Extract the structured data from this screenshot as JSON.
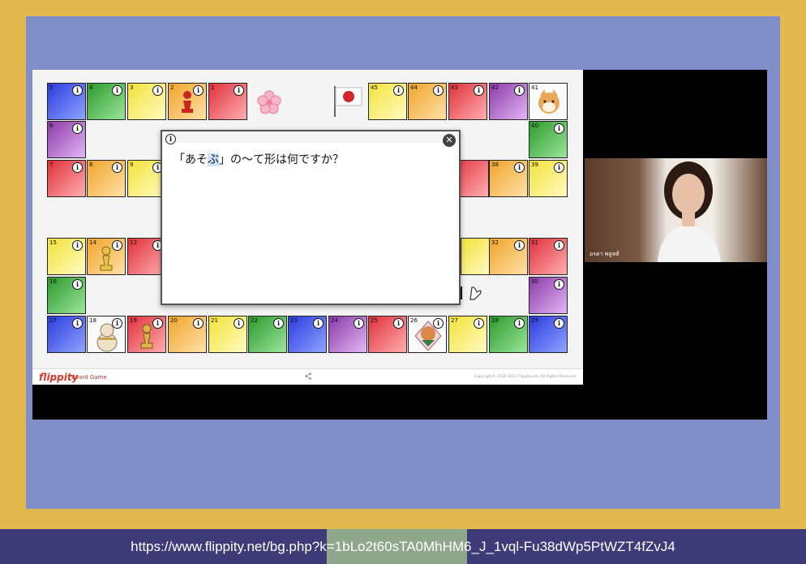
{
  "app": {
    "brand": "flippity",
    "subtitle": "Board Game",
    "copyright": "Copyright© 2020-2021 Flippity.net. All Rights Reserved"
  },
  "icons": {
    "info": "i",
    "close": "✕",
    "share": "share-icon"
  },
  "tiles": [
    {
      "n": "5",
      "c": "blue"
    },
    {
      "n": "4",
      "c": "green"
    },
    {
      "n": "3",
      "c": "yellow"
    },
    {
      "n": "2",
      "c": "orange"
    },
    {
      "n": "1",
      "c": "red"
    },
    {
      "n": "45",
      "c": "yellow"
    },
    {
      "n": "44",
      "c": "orange"
    },
    {
      "n": "43",
      "c": "red"
    },
    {
      "n": "42",
      "c": "purple"
    },
    {
      "n": "41",
      "c": "white"
    },
    {
      "n": "6",
      "c": "purple"
    },
    {
      "n": "40",
      "c": "green"
    },
    {
      "n": "7",
      "c": "red"
    },
    {
      "n": "8",
      "c": "orange"
    },
    {
      "n": "9",
      "c": "yellow"
    },
    {
      "n": "38",
      "c": "orange"
    },
    {
      "n": "39",
      "c": "yellow"
    },
    {
      "n": "15",
      "c": "yellow"
    },
    {
      "n": "14",
      "c": "orange"
    },
    {
      "n": "13",
      "c": "red"
    },
    {
      "n": "32",
      "c": "orange"
    },
    {
      "n": "31",
      "c": "red"
    },
    {
      "n": "16",
      "c": "green"
    },
    {
      "n": "30",
      "c": "purple"
    },
    {
      "n": "17",
      "c": "blue"
    },
    {
      "n": "18",
      "c": "white"
    },
    {
      "n": "19",
      "c": "red"
    },
    {
      "n": "20",
      "c": "orange"
    },
    {
      "n": "21",
      "c": "yellow"
    },
    {
      "n": "22",
      "c": "green"
    },
    {
      "n": "23",
      "c": "blue"
    },
    {
      "n": "24",
      "c": "purple"
    },
    {
      "n": "25",
      "c": "red"
    },
    {
      "n": "26",
      "c": "white"
    },
    {
      "n": "27",
      "c": "yellow"
    },
    {
      "n": "28",
      "c": "green"
    },
    {
      "n": "29",
      "c": "blue"
    }
  ],
  "modal": {
    "q1": "「あそ",
    "q_hl": "ぶ",
    "q2": "」の〜て形は何ですか？"
  },
  "camera": {
    "name": "อรดา พลูทส์"
  },
  "url": "https://www.flippity.net/bg.php?k=1bLo2t60sTA0MhHM6_J_1vql-Fu38dWp5PtWZT4fZvJ4"
}
